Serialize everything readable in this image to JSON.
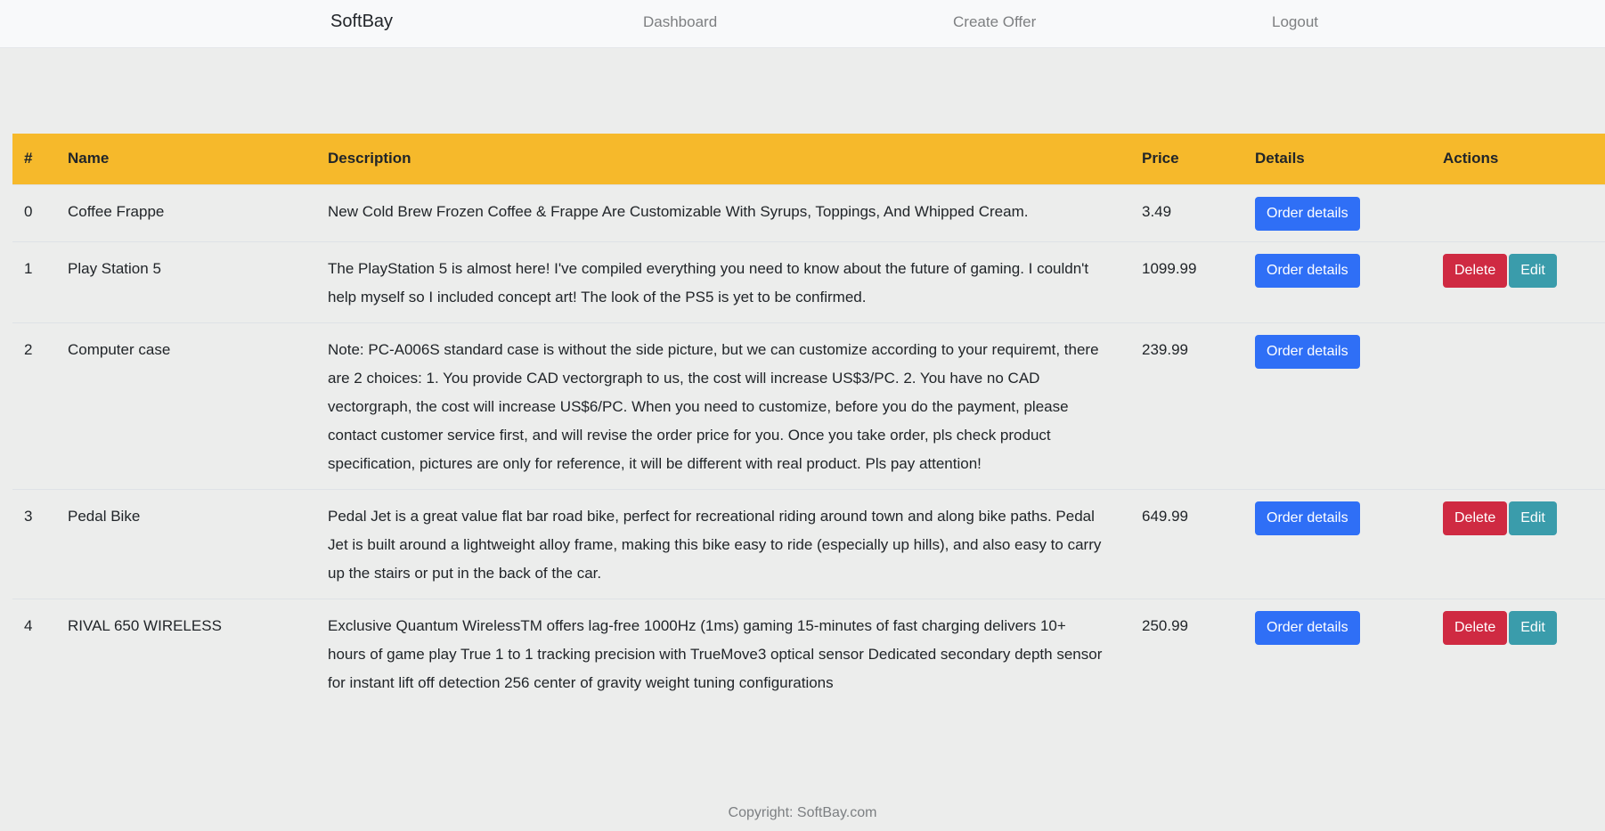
{
  "nav": {
    "brand": "SoftBay",
    "links": [
      "Dashboard",
      "Create Offer",
      "Logout"
    ]
  },
  "table": {
    "headers": [
      "#",
      "Name",
      "Description",
      "Price",
      "Details",
      "Actions"
    ],
    "rows": [
      {
        "index": "0",
        "name": "Coffee Frappe",
        "description": "New Cold Brew Frozen Coffee & Frappe Are Customizable With Syrups, Toppings, And Whipped Cream.",
        "price": "3.49",
        "details_label": "Order details",
        "has_actions": false
      },
      {
        "index": "1",
        "name": "Play Station 5",
        "description": "The PlayStation 5 is almost here! I've compiled everything you need to know about the future of gaming. I couldn't help myself so I included concept art! The look of the PS5 is yet to be confirmed.",
        "price": "1099.99",
        "details_label": "Order details",
        "has_actions": true,
        "delete_label": "Delete",
        "edit_label": "Edit"
      },
      {
        "index": "2",
        "name": "Computer case",
        "description": "Note: PC-A006S standard case is without the side picture, but we can customize according to your requiremt, there are 2 choices: 1. You provide CAD vectorgraph to us, the cost will increase US$3/PC. 2. You have no CAD vectorgraph, the cost will increase US$6/PC. When you need to customize, before you do the payment, please contact customer service first, and will revise the order price for you. Once you take order, pls check product specification, pictures are only for reference, it will be different with real product. Pls pay attention!",
        "price": "239.99",
        "details_label": "Order details",
        "has_actions": false
      },
      {
        "index": "3",
        "name": "Pedal Bike",
        "description": "Pedal Jet is a great value flat bar road bike, perfect for recreational riding around town and along bike paths. Pedal Jet is built around a lightweight alloy frame, making this bike easy to ride (especially up hills), and also easy to carry up the stairs or put in the back of the car.",
        "price": "649.99",
        "details_label": "Order details",
        "has_actions": true,
        "delete_label": "Delete",
        "edit_label": "Edit"
      },
      {
        "index": "4",
        "name": "RIVAL 650 WIRELESS",
        "description": "Exclusive Quantum WirelessTM offers lag-free 1000Hz (1ms) gaming 15-minutes of fast charging delivers 10+ hours of game play True 1 to 1 tracking precision with TrueMove3 optical sensor Dedicated secondary depth sensor for instant lift off detection 256 center of gravity weight tuning configurations",
        "price": "250.99",
        "details_label": "Order details",
        "has_actions": true,
        "delete_label": "Delete",
        "edit_label": "Edit"
      }
    ]
  },
  "footer": {
    "copyright": "Copyright: SoftBay.com"
  },
  "colors": {
    "header_bg": "#f6b92b",
    "primary": "#2f6ff6",
    "danger": "#cf2a42",
    "info": "#3a9cab"
  }
}
